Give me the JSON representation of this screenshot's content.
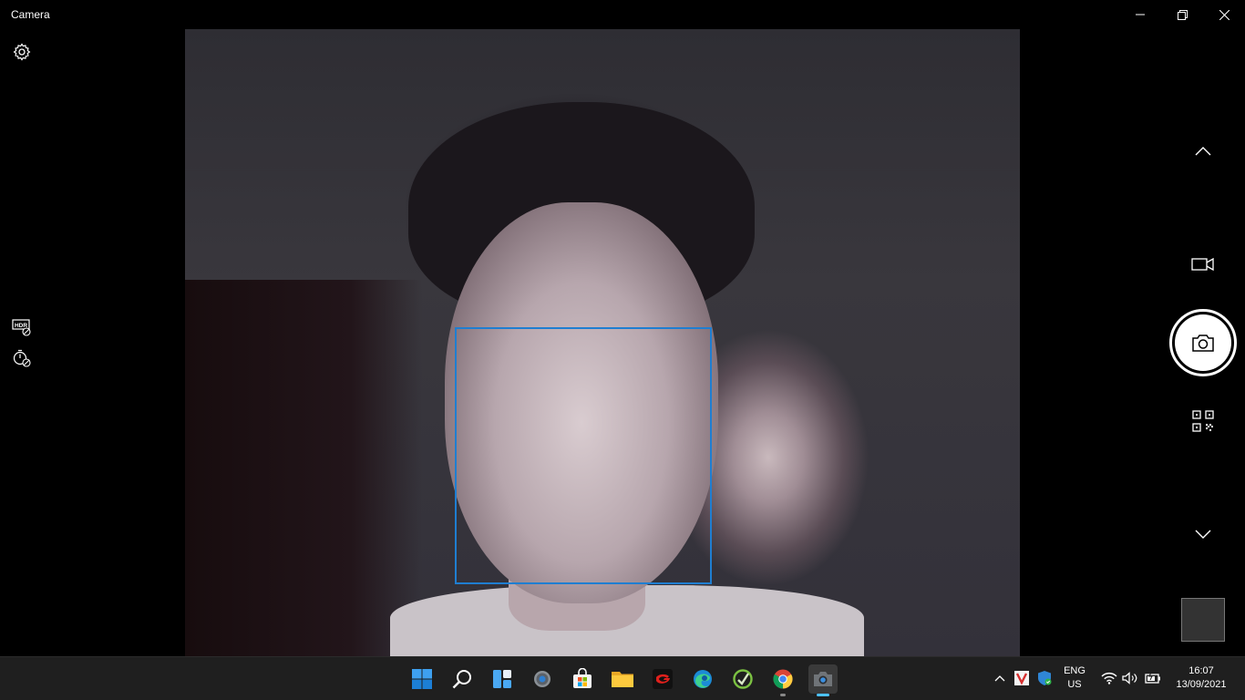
{
  "window": {
    "title": "Camera",
    "minimize_icon": "minimize-icon",
    "restore_icon": "restore-icon",
    "close_icon": "close-icon"
  },
  "camera": {
    "settings_icon": "gear-icon",
    "hdr_icon": "hdr-off-icon",
    "timer_icon": "timer-off-icon",
    "scroll_up_icon": "chevron-up-icon",
    "video_mode_icon": "video-camera-icon",
    "photo_button_icon": "camera-icon",
    "qr_mode_icon": "qr-code-icon",
    "scroll_down_icon": "chevron-down-icon",
    "face_box_color": "#1f7ed1"
  },
  "taskbar": {
    "apps": [
      {
        "name": "Start",
        "icon": "windows-logo-icon"
      },
      {
        "name": "Search",
        "icon": "search-icon"
      },
      {
        "name": "Widgets",
        "icon": "widgets-icon"
      },
      {
        "name": "Settings",
        "icon": "settings-icon"
      },
      {
        "name": "Microsoft Store",
        "icon": "store-icon"
      },
      {
        "name": "File Explorer",
        "icon": "folder-icon"
      },
      {
        "name": "Garena",
        "icon": "garena-icon"
      },
      {
        "name": "Microsoft Edge",
        "icon": "edge-icon"
      },
      {
        "name": "App",
        "icon": "green-app-icon"
      },
      {
        "name": "Google Chrome",
        "icon": "chrome-icon"
      },
      {
        "name": "Camera",
        "icon": "camera-app-icon"
      }
    ],
    "tray": {
      "language": "ENG",
      "region": "US",
      "time": "16:07",
      "date": "13/09/2021"
    }
  }
}
